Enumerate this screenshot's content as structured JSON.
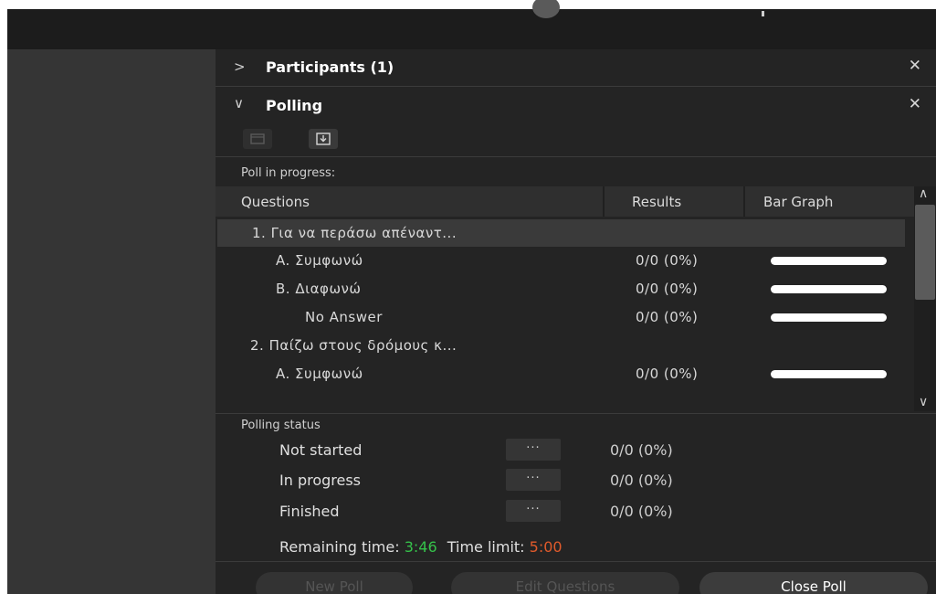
{
  "participants": {
    "title": "Participants (1)"
  },
  "polling": {
    "title": "Polling",
    "progress_label": "Poll in progress:",
    "columns": {
      "questions": "Questions",
      "results": "Results",
      "bar_graph": "Bar Graph"
    },
    "questions": [
      {
        "text": "1.  Για να περάσω απέναντ...",
        "answers": [
          {
            "text": "A.  Συμφωνώ",
            "result": "0/0 (0%)",
            "fraction": 0
          },
          {
            "text": "B.  Διαφωνώ",
            "result": "0/0 (0%)",
            "fraction": 0
          },
          {
            "text": "No Answer",
            "result": "0/0 (0%)",
            "fraction": 0
          }
        ]
      },
      {
        "text": "2.  Παίζω στους δρόμους κ...",
        "answers": [
          {
            "text": "A.  Συμφωνώ",
            "result": "0/0 (0%)",
            "fraction": 0
          }
        ]
      }
    ],
    "status_label": "Polling status",
    "status": [
      {
        "name": "Not started",
        "more": "···",
        "value": "0/0 (0%)"
      },
      {
        "name": "In progress",
        "more": "···",
        "value": "0/0 (0%)"
      },
      {
        "name": "Finished",
        "more": "···",
        "value": "0/0 (0%)"
      }
    ],
    "remaining_label": "Remaining time:",
    "remaining_value": "3:46",
    "limit_label": "Time limit:",
    "limit_value": "5:00",
    "buttons": {
      "new_poll": "New Poll",
      "edit_questions": "Edit Questions",
      "close_poll": "Close Poll"
    }
  },
  "icons": {
    "collapsed": "chevron-right-icon",
    "expanded": "chevron-down-icon",
    "close": "close-icon",
    "folder": "folder-icon",
    "download": "download-icon"
  },
  "colors": {
    "remaining": "#35c24a",
    "limit": "#e05a2b",
    "panel": "#242424"
  }
}
